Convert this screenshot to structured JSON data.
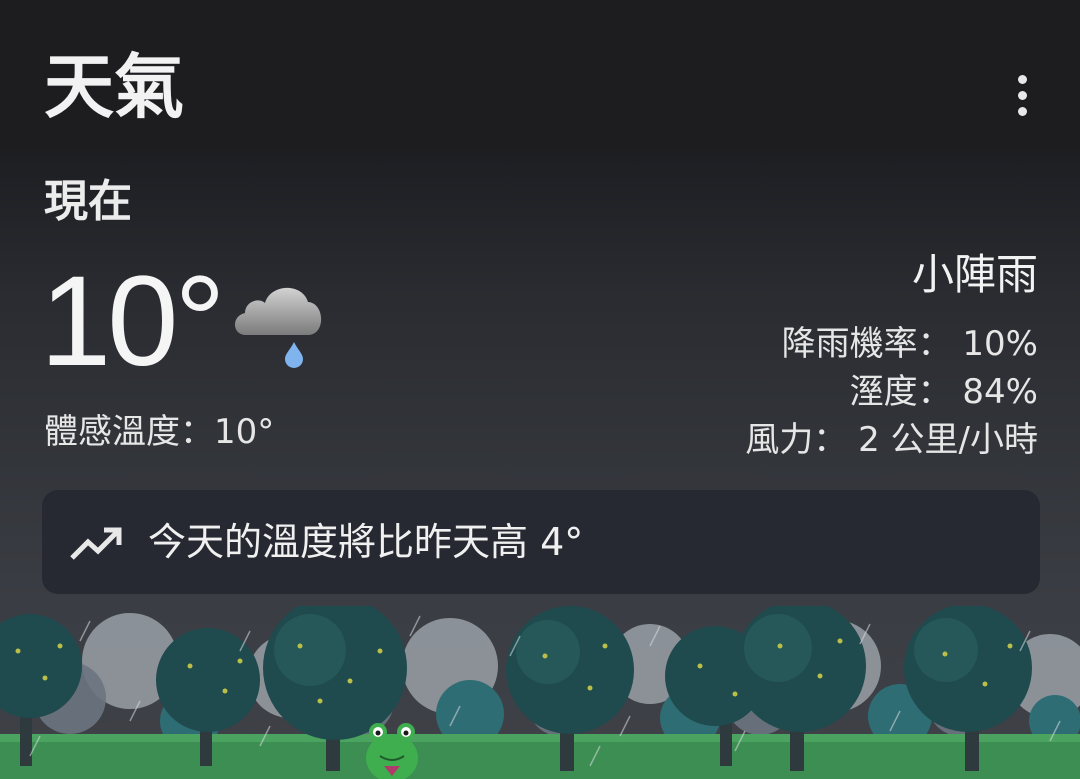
{
  "app": {
    "title": "天氣"
  },
  "current": {
    "section_label": "現在",
    "temperature": "10°",
    "feels_like": "體感溫度：10°",
    "condition": "小陣雨",
    "icon": "cloud-rain-icon"
  },
  "details": {
    "precip": "降雨機率： 10%",
    "humidity": "溼度： 84%",
    "wind": "風力： 2 公里/小時"
  },
  "trend": {
    "icon": "trending-up-icon",
    "text": "今天的溫度將比昨天高 4°"
  },
  "colors": {
    "background": "#2a2c31",
    "topbar": "#1d1d1f",
    "card": "#272932",
    "raindrop": "#7fb4ef",
    "grass": "#3c8e52"
  }
}
